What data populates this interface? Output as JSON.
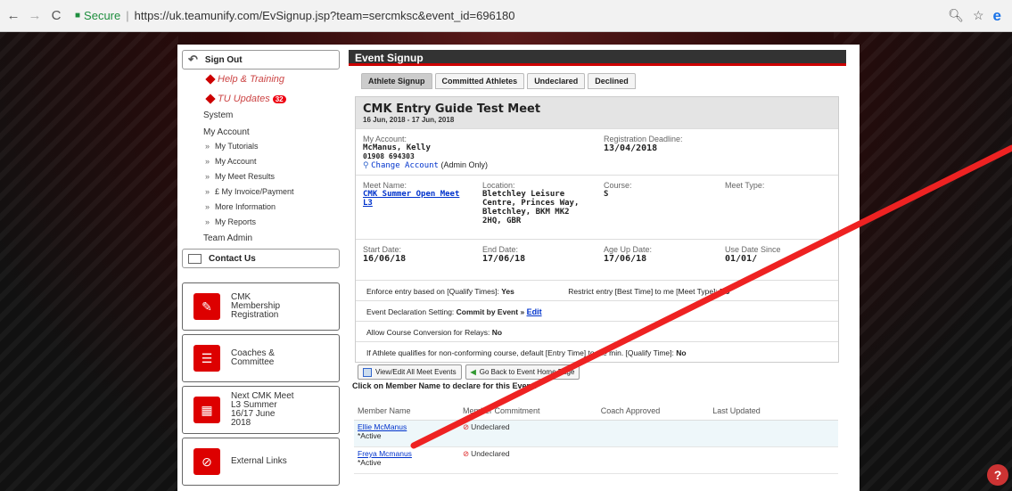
{
  "browser": {
    "secure_label": "Secure",
    "url": "https://uk.teamunify.com/EvSignup.jsp?team=sercmksc&event_id=696180"
  },
  "sidebar": {
    "signout": "Sign Out",
    "help": "Help & Training",
    "updates": "TU Updates",
    "updates_count": "32",
    "system": "System",
    "my_account_head": "My Account",
    "items": [
      "My Tutorials",
      "My Account",
      "My Meet Results",
      "£ My Invoice/Payment",
      "More Information",
      "My Reports"
    ],
    "team_admin": "Team Admin",
    "contact": "Contact Us",
    "tiles": [
      "CMK\nMembership\nRegistration",
      "Coaches &\nCommittee",
      "Next CMK Meet\nL3 Summer\n16/17 June\n2018",
      "External Links"
    ]
  },
  "main": {
    "header": "Event Signup",
    "tabs": [
      "Athlete Signup",
      "Committed Athletes",
      "Undeclared",
      "Declined"
    ],
    "meet_title": "CMK Entry Guide Test Meet",
    "meet_dates": "16 Jun, 2018 - 17 Jun, 2018",
    "account_label": "My Account:",
    "account_name": "McManus, Kelly",
    "account_phone": "01908 694303",
    "change_account": "Change Account",
    "change_account_suffix": "(Admin Only)",
    "deadline_label": "Registration Deadline:",
    "deadline": "13/04/2018",
    "meet_name_label": "Meet Name:",
    "meet_name": "CMK Summer Open Meet L3",
    "location_label": "Location:",
    "location": "Bletchley Leisure Centre, Princes Way, Bletchley, BKM MK2 2HQ, GBR",
    "course_label": "Course:",
    "course": "S",
    "meet_type_label": "Meet Type:",
    "start_label": "Start Date:",
    "start": "16/06/18",
    "end_label": "End Date:",
    "end": "17/06/18",
    "ageup_label": "Age Up Date:",
    "ageup": "17/06/18",
    "usedate_label": "Use Date Since",
    "usedate": "01/01/",
    "opt1a": "Enforce entry based on [Qualify Times]:",
    "opt1b": "Yes",
    "opt1c": "Restrict entry [Best Time] to",
    "opt1d": "me [Meet Type]:",
    "opt1e": "No",
    "opt2a": "Event Declaration Setting:",
    "opt2b": "Commit by Event »",
    "opt2c": "Edit",
    "opt3a": "Allow Course Conversion for Relays:",
    "opt3b": "No",
    "opt4a": "If Athlete qualifies for non-conforming course, default [Entry Time] to the min. [Qualify Time]:",
    "opt4b": "No",
    "btn_view": "View/Edit All Meet Events",
    "btn_back": "Go Back to Event Home Page",
    "instruction": "Click on Member Name to declare for this Event:",
    "cols": [
      "Member Name",
      "Member Commitment",
      "Coach Approved",
      "Last Updated"
    ],
    "members": [
      {
        "name": "Ellie McManus",
        "status": "*Active",
        "commit": "Undeclared"
      },
      {
        "name": "Freya Mcmanus",
        "status": "*Active",
        "commit": "Undeclared"
      }
    ]
  },
  "help": "?"
}
